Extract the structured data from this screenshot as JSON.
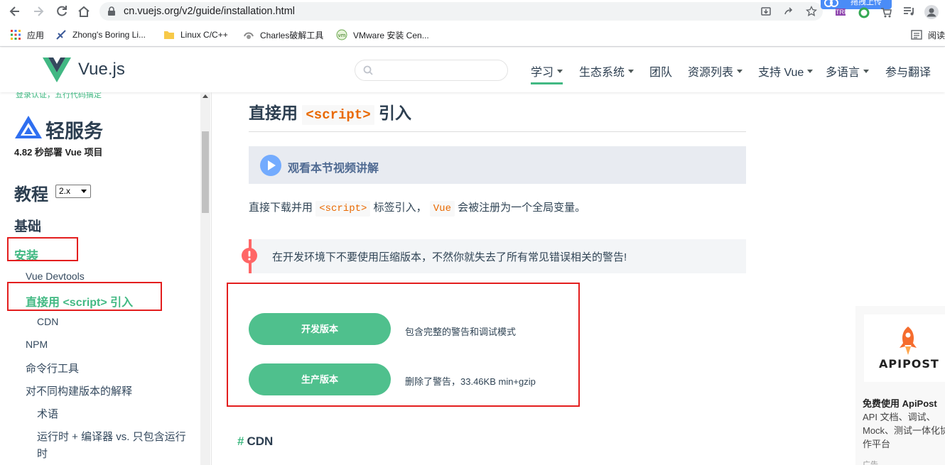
{
  "browser": {
    "url": "cn.vuejs.org/v2/guide/installation.html",
    "upload_label": "拖拽上传",
    "reader_label": "阅读",
    "bookmarks": [
      {
        "label": "应用",
        "icon": "apps-grid-icon"
      },
      {
        "label": "Zhong's Boring Li...",
        "icon": "site-favicon-icon"
      },
      {
        "label": "Linux C/C++",
        "icon": "folder-icon"
      },
      {
        "label": "Charles破解工具",
        "icon": "charles-favicon-icon"
      },
      {
        "label": "VMware 安装 Cen...",
        "icon": "vmware-favicon-icon"
      }
    ]
  },
  "header": {
    "logo_text": "Vue.js",
    "nav": [
      {
        "label": "学习",
        "dropdown": true,
        "active": true
      },
      {
        "label": "生态系统",
        "dropdown": true
      },
      {
        "label": "团队",
        "dropdown": false
      },
      {
        "label": "资源列表",
        "dropdown": true
      },
      {
        "label": "支持 Vue",
        "dropdown": true
      },
      {
        "label": "多语言",
        "dropdown": true
      },
      {
        "label": "参与翻译",
        "dropdown": false
      }
    ]
  },
  "sidebar": {
    "banner_text": "登录认证，五行代码搞定",
    "sponsor_brand": "轻服务",
    "sponsor_tagline": "4.82 秒部署 Vue 项目",
    "heading": "教程",
    "version": "2.x",
    "section": "基础",
    "items": [
      {
        "label": "安装",
        "active": true
      },
      {
        "label": "Vue Devtools"
      },
      {
        "label": "直接用 <script> 引入",
        "active": true
      },
      {
        "label": "CDN"
      },
      {
        "label": "NPM"
      },
      {
        "label": "命令行工具"
      },
      {
        "label": "对不同构建版本的解释"
      },
      {
        "label": "术语"
      },
      {
        "label": "运行时 + 编译器 vs. 只包含运行"
      },
      {
        "label": "时"
      }
    ]
  },
  "content": {
    "heading_prefix": "直接用",
    "heading_code": "<script>",
    "heading_suffix": "引入",
    "video_label": "观看本节视频讲解",
    "para_part1": "直接下载并用",
    "para_code1": "<script>",
    "para_part2": "标签引入，",
    "para_code2": "Vue",
    "para_part3": "会被注册为一个全局变量。",
    "warning": "在开发环境下不要使用压缩版本，不然你就失去了所有常见错误相关的警告!",
    "downloads": [
      {
        "label": "开发版本",
        "desc": "包含完整的警告和调试模式"
      },
      {
        "label": "生产版本",
        "desc": "删除了警告，33.46KB min+gzip"
      }
    ],
    "next_heading_hash": "#",
    "next_heading": "CDN"
  },
  "ad": {
    "brand": "APIPOST",
    "title": "免费使用 ApiPost",
    "desc": "API 文档、调试、Mock、测试一体化协作平台",
    "label": "广告"
  },
  "colors": {
    "vue_green": "#42b983",
    "button_green": "#4fc08d",
    "code_orange": "#e96900",
    "annotation_red": "#e31e1e",
    "warning_red": "#ff6666"
  }
}
